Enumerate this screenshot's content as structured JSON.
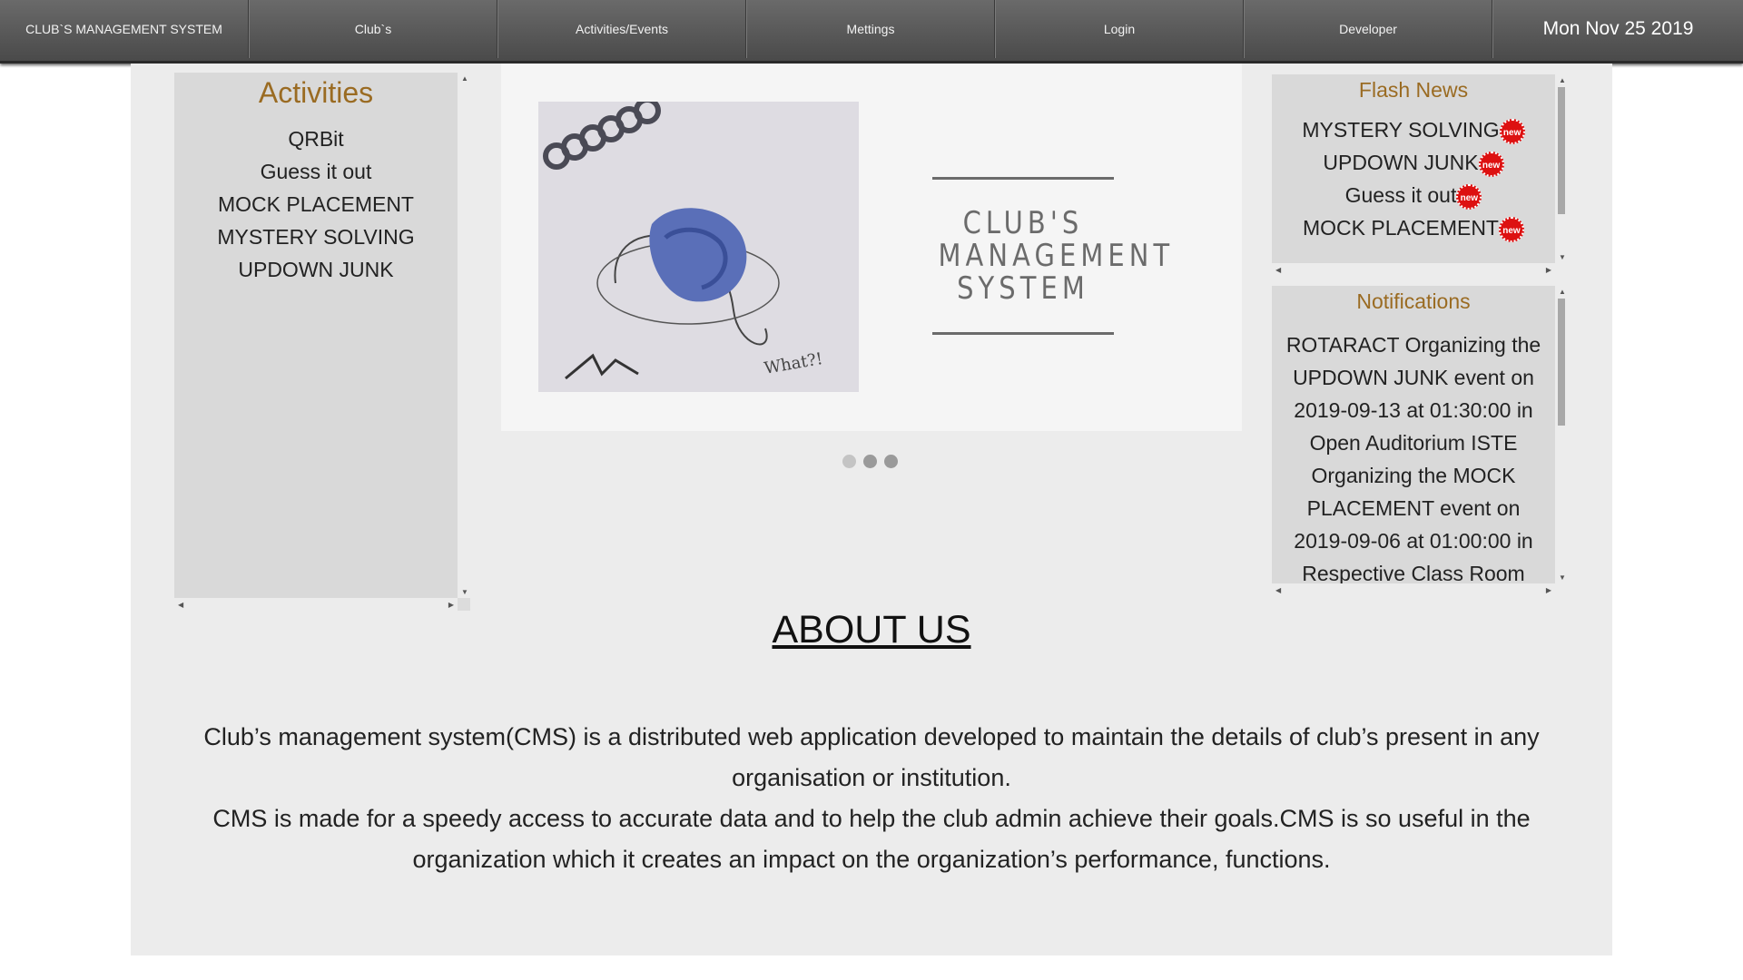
{
  "nav": {
    "items": [
      "CLUB`S MANAGEMENT SYSTEM",
      "Club`s",
      "Activities/Events",
      "Mettings",
      "Login",
      "Developer"
    ],
    "date": "Mon Nov 25 2019"
  },
  "activities": {
    "title": "Activities",
    "items": [
      "QRBit",
      "Guess it out",
      "MOCK PLACEMENT",
      "MYSTERY SOLVING",
      "UPDOWN JUNK"
    ]
  },
  "carousel": {
    "logo_lines": [
      "CLUB'S",
      "MANAGEMENT",
      "SYSTEM"
    ],
    "slide_count": 3
  },
  "flash_news": {
    "title": "Flash News",
    "items": [
      "MYSTERY SOLVING",
      "UPDOWN JUNK",
      "Guess it out",
      "MOCK PLACEMENT"
    ],
    "badge": "new"
  },
  "notifications": {
    "title": "Notifications",
    "text": "ROTARACT Organizing the UPDOWN JUNK event on 2019-09-13 at 01:30:00 in Open Auditorium ISTE Organizing the MOCK PLACEMENT event on 2019-09-06 at 01:00:00 in Respective Class Room"
  },
  "about": {
    "title": "ABOUT US",
    "paragraphs": [
      "Club’s management system(CMS) is a distributed web application developed to maintain the details of club’s present in any organisation or institution.",
      "CMS is made for a speedy access to accurate data and to help the club admin achieve their goals.CMS is so useful in the organization which it creates an impact on the organization’s performance, functions."
    ]
  }
}
